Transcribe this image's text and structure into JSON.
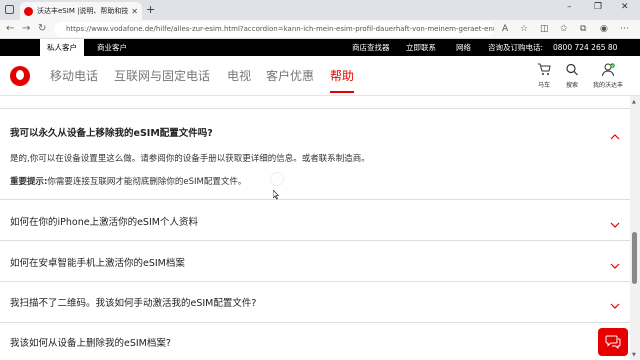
{
  "browser": {
    "tab_title": "沃达丰eSIM |说明、帮助和技巧",
    "tab_close": "✕",
    "new_tab": "+",
    "url": "https://www.vodafone.de/hilfe/alles-zur-esim.html?accordion=kann-ich-mein-esim-profil-dauerhaft-von-meinem-geraet-entfernen",
    "window_controls": [
      "–",
      "❐",
      "✕"
    ]
  },
  "topbar": {
    "segments": [
      "私人客户",
      "商业客户"
    ],
    "links": [
      "商店查找器",
      "立即联系",
      "网络"
    ],
    "hotline_label": "咨询及订购电话:",
    "hotline_number": "0800 724 265 80"
  },
  "nav": {
    "items": [
      "移动电话",
      "互联网与固定电话",
      "电视",
      "客户优惠",
      "帮助"
    ],
    "active_index": 4,
    "utilities": [
      {
        "label": "马车",
        "icon": "cart-icon"
      },
      {
        "label": "搜索",
        "icon": "search-icon"
      },
      {
        "label": "我的沃达丰",
        "icon": "user-icon"
      }
    ]
  },
  "faq": {
    "open_question": "我可以永久从设备上移除我的eSIM配置文件吗?",
    "answer_text": "是的,你可以在设备设置里这么做。请参阅你的设备手册以获取更详细的信息。或者联系制造商。",
    "note_label": "重要提示:",
    "note_text": "你需要连接互联网才能彻底删除你的eSIM配置文件。",
    "questions": [
      "如何在你的iPhone上激活你的eSIM个人资料",
      "如何在安卓智能手机上激活你的eSIM档案",
      "我扫描不了二维码。我该如何手动激活我的eSIM配置文件?",
      "我该如何从设备上删除我的eSIM档案?"
    ]
  },
  "colors": {
    "brand_red": "#e60000",
    "topbar_bg": "#000000"
  }
}
